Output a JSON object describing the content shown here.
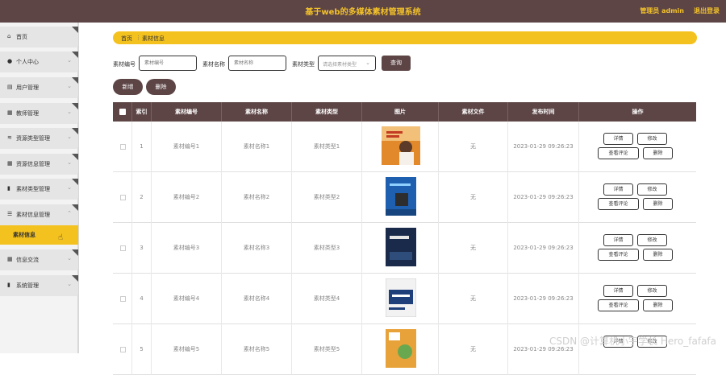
{
  "header": {
    "title": "基于web的多媒体素材管理系统",
    "user": "管理员 admin",
    "logout": "退出登录"
  },
  "sidebar": {
    "items": [
      {
        "label": "首页",
        "icon": "home-icon",
        "glyph": "⌂"
      },
      {
        "label": "个人中心",
        "icon": "person-icon",
        "glyph": "👤"
      },
      {
        "label": "用户管理",
        "icon": "list-icon",
        "glyph": "▤"
      },
      {
        "label": "教师管理",
        "icon": "grid-icon",
        "glyph": "▦"
      },
      {
        "label": "资源类型管理",
        "icon": "layers-icon",
        "glyph": "≋"
      },
      {
        "label": "资源信息管理",
        "icon": "grid-icon",
        "glyph": "▦"
      },
      {
        "label": "素材类型管理",
        "icon": "bar-chart-icon",
        "glyph": "▮"
      },
      {
        "label": "素材信息管理",
        "icon": "sliders-icon",
        "glyph": "☰"
      },
      {
        "label": "信息交流",
        "icon": "grid-icon",
        "glyph": "▦"
      },
      {
        "label": "系统管理",
        "icon": "chart-icon",
        "glyph": "▮"
      }
    ],
    "active_sub": "素材信息"
  },
  "breadcrumb": {
    "home": "首页",
    "separator": "⋮",
    "current": "素材信息"
  },
  "search": {
    "code_label": "素材编号",
    "code_placeholder": "素材编号",
    "name_label": "素材名称",
    "name_placeholder": "素材名称",
    "type_label": "素材类型",
    "type_placeholder": "请选择素材类型",
    "query_button": "查询"
  },
  "actions": {
    "add": "新增",
    "delete": "删除"
  },
  "table": {
    "columns": [
      "索引",
      "素材编号",
      "素材名称",
      "素材类型",
      "图片",
      "素材文件",
      "发布时间",
      "操作"
    ],
    "rows": [
      {
        "index": "1",
        "code": "素材编号1",
        "name": "素材名称1",
        "type": "素材类型1",
        "file": "无",
        "time": "2023-01-29 09:26:23"
      },
      {
        "index": "2",
        "code": "素材编号2",
        "name": "素材名称2",
        "type": "素材类型2",
        "file": "无",
        "time": "2023-01-29 09:26:23"
      },
      {
        "index": "3",
        "code": "素材编号3",
        "name": "素材名称3",
        "type": "素材类型3",
        "file": "无",
        "time": "2023-01-29 09:26:23"
      },
      {
        "index": "4",
        "code": "素材编号4",
        "name": "素材名称4",
        "type": "素材类型4",
        "file": "无",
        "time": "2023-01-29 09:26:23"
      },
      {
        "index": "5",
        "code": "素材编号5",
        "name": "素材名称5",
        "type": "素材类型5",
        "file": "无",
        "time": "2023-01-29 09:26:23"
      }
    ],
    "btn_detail": "详情",
    "btn_edit": "修改",
    "btn_comments": "查看评论",
    "btn_delete": "删除"
  },
  "watermark": "CSDN @计算机小宇学长 Hero_fafafa",
  "colors": {
    "header": "#5d4546",
    "accent": "#f4c21f",
    "title_text": "#f3c22a"
  }
}
